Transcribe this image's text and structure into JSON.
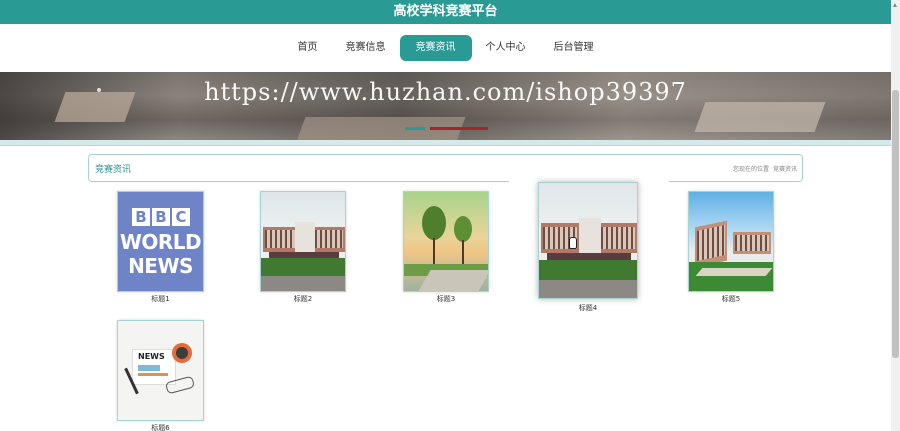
{
  "header": {
    "title": "高校学科竞赛平台"
  },
  "nav": {
    "items": [
      {
        "label": "首页",
        "active": false
      },
      {
        "label": "竞赛信息",
        "active": false
      },
      {
        "label": "竞赛资讯",
        "active": true
      },
      {
        "label": "个人中心",
        "active": false
      },
      {
        "label": "后台管理",
        "active": false
      }
    ]
  },
  "banner": {
    "watermark": "https://www.huzhan.com/ishop39397"
  },
  "section": {
    "title": "竞赛资讯",
    "breadcrumb_prefix": "您现在的位置",
    "breadcrumb_current": "竞赛资讯"
  },
  "cards": [
    {
      "label": "标题1",
      "image": "bbc-world-news",
      "bbc": [
        "B",
        "B",
        "C"
      ],
      "bbc_line1": "WORLD",
      "bbc_line2": "NEWS"
    },
    {
      "label": "标题2",
      "image": "campus-building"
    },
    {
      "label": "标题3",
      "image": "campus-trees-sunset"
    },
    {
      "label": "标题4",
      "image": "campus-building",
      "hover": true
    },
    {
      "label": "标题5",
      "image": "campus-aerial"
    },
    {
      "label": "标题6",
      "image": "news-illustration",
      "news_text": "NEWS"
    }
  ],
  "colors": {
    "accent": "#2a9a95",
    "border": "#a8d3d3"
  }
}
